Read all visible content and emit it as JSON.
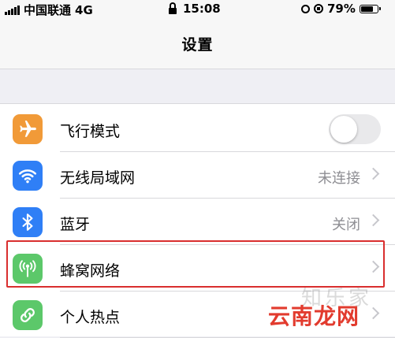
{
  "status_bar": {
    "carrier": "中国联通",
    "network": "4G",
    "time": "15:08",
    "battery": "79%",
    "battery_level": 0.79
  },
  "nav": {
    "title": "设置"
  },
  "settings": [
    {
      "id": "airplane",
      "label": "飞行模式",
      "value": "",
      "icon": "airplane-icon",
      "color": "#f19a38",
      "control": "toggle",
      "toggle_on": false
    },
    {
      "id": "wifi",
      "label": "无线局域网",
      "value": "未连接",
      "icon": "wifi-icon",
      "color": "#2f7ff6",
      "control": "chevron"
    },
    {
      "id": "bluetooth",
      "label": "蓝牙",
      "value": "关闭",
      "icon": "bluetooth-icon",
      "color": "#2f7ff6",
      "control": "chevron"
    },
    {
      "id": "cellular",
      "label": "蜂窝网络",
      "value": "",
      "icon": "cellular-antenna-icon",
      "color": "#5cc86a",
      "control": "chevron"
    },
    {
      "id": "hotspot",
      "label": "个人热点",
      "value": "",
      "icon": "hotspot-link-icon",
      "color": "#5cc86a",
      "control": "chevron"
    }
  ],
  "highlight_color": "#d92e2e",
  "watermark": {
    "text": "云南龙网",
    "faint": "知乐家"
  }
}
